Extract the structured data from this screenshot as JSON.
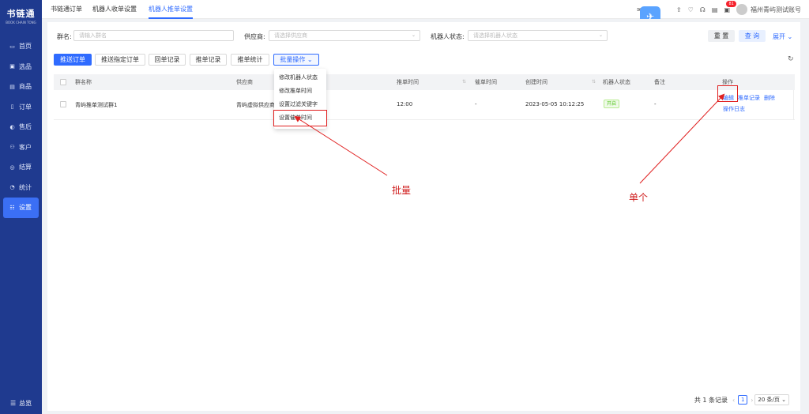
{
  "app": {
    "logo_main": "书链通",
    "logo_sub": "BOOK CHAIN TONG"
  },
  "sidebar": {
    "items": [
      {
        "icon": "home-icon",
        "glyph": "▭",
        "label": "首页"
      },
      {
        "icon": "select-icon",
        "glyph": "▣",
        "label": "选品"
      },
      {
        "icon": "goods-icon",
        "glyph": "▤",
        "label": "商品"
      },
      {
        "icon": "order-icon",
        "glyph": "▯",
        "label": "订单"
      },
      {
        "icon": "aftersale-icon",
        "glyph": "◐",
        "label": "售后"
      },
      {
        "icon": "customer-icon",
        "glyph": "⚇",
        "label": "客户"
      },
      {
        "icon": "settle-icon",
        "glyph": "◎",
        "label": "结算"
      },
      {
        "icon": "stats-icon",
        "glyph": "◔",
        "label": "统计"
      },
      {
        "icon": "settings-icon",
        "glyph": "☷",
        "label": "设置"
      }
    ],
    "bottom_label": "总览"
  },
  "topbar": {
    "tabs": [
      "书链通订单",
      "机器人收单设置",
      "机器人推单设置"
    ],
    "new_label": "新",
    "badge": "81",
    "account": "福州青屿测试账号"
  },
  "filters": {
    "group_label": "群名:",
    "group_placeholder": "请输入群名",
    "supplier_label": "供应商:",
    "supplier_placeholder": "请选择供应商",
    "status_label": "机器人状态:",
    "status_placeholder": "请选择机器人状态",
    "reset": "重 置",
    "search": "查 询",
    "expand": "展开"
  },
  "toolbar": {
    "push_order": "推送订单",
    "push_specific": "推送指定订单",
    "return_record": "回单记录",
    "push_record": "推单记录",
    "push_stats": "推单统计",
    "batch": "批量操作"
  },
  "table": {
    "headers": [
      "群名称",
      "供应商",
      "推单时间",
      "催单时间",
      "创建时间",
      "机器人状态",
      "备注",
      "操作"
    ],
    "rows": [
      {
        "group": "青屿推单测试群1",
        "supplier": "青屿虚拟供应商",
        "push_time": "12:00",
        "remind_time": "-",
        "created": "2023-05-05 10:12:25",
        "status": "开启",
        "note": "-",
        "actions": [
          "编辑",
          "推单记录",
          "删除",
          "操作日志"
        ]
      }
    ]
  },
  "dropdown": [
    "修改机器人状态",
    "修改推单时间",
    "设置过滤关键字",
    "设置催单时间"
  ],
  "pagination": {
    "total": "共 1 条记录",
    "page": "1",
    "page_size": "20 条/页"
  },
  "annotations": {
    "batch": "批量",
    "single": "单个"
  },
  "colors": {
    "primary": "#2f6bff",
    "sidebar": "#1f3a8f",
    "annotation": "#e02020"
  }
}
